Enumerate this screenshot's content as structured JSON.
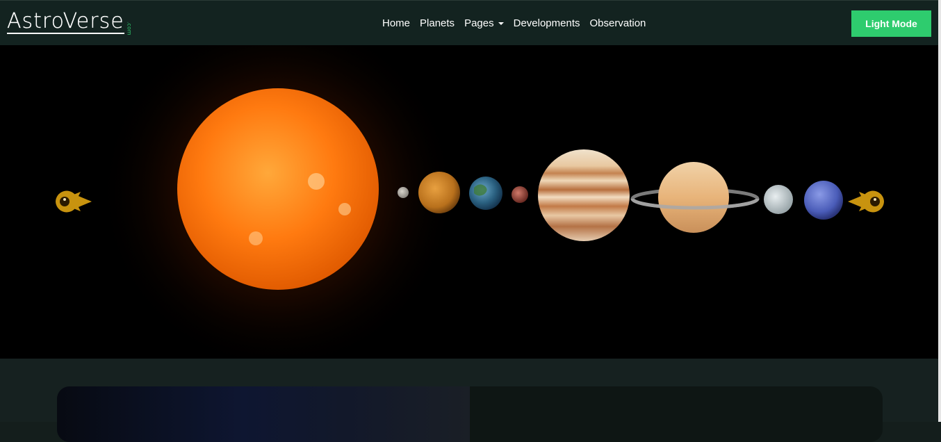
{
  "brand": {
    "name": "AstroVerse",
    "suffix": ".com"
  },
  "nav": {
    "items": [
      {
        "label": "Home"
      },
      {
        "label": "Planets"
      },
      {
        "label": "Pages"
      },
      {
        "label": "Developments"
      },
      {
        "label": "Observation"
      }
    ]
  },
  "mode_button": {
    "label": "Light Mode"
  },
  "colors": {
    "navbar_bg": "#132320",
    "accent": "#2ecc6e",
    "arrow": "#c8930f",
    "page_bg": "#162120"
  },
  "carousel": {
    "prev_icon": "rocket-left-icon",
    "next_icon": "rocket-right-icon"
  }
}
